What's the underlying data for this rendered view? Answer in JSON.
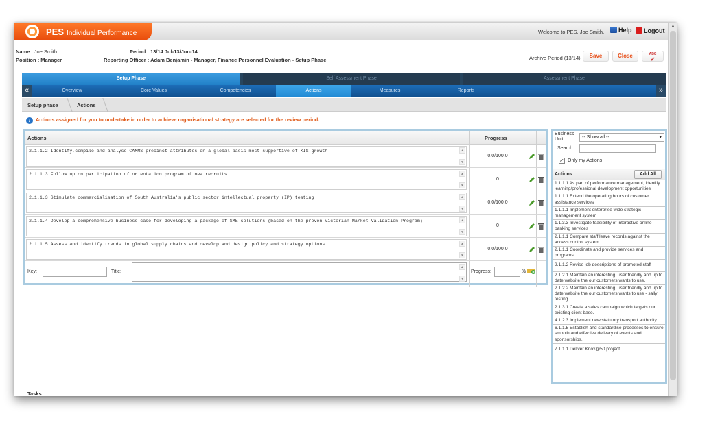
{
  "header": {
    "app_name": "PES",
    "app_subtitle": "Individual Performance",
    "welcome": "Welcome to PES, Joe Smith.",
    "help": "Help",
    "logout": "Logout"
  },
  "info": {
    "name_label": "Name",
    "name_value": ": Joe Smith",
    "position_label": "Position",
    "position_value": ": Manager",
    "period_label": "Period",
    "period_value": ": 13/14 Jul-13/Jun-14",
    "officer_label": "Reporting Officer",
    "officer_value": ": Adam Benjamin - Manager, Finance Personnel Evaluation - Setup Phase",
    "archive_period": "Archive Period (13/14)",
    "save": "Save",
    "close": "Close",
    "spell": "ABC"
  },
  "phases": [
    {
      "label": "Setup Phase",
      "active": true
    },
    {
      "label": "Self Assessment Phase",
      "active": false
    },
    {
      "label": "Assessment Phase",
      "active": false
    }
  ],
  "tabs": [
    {
      "label": "Overview"
    },
    {
      "label": "Core Values"
    },
    {
      "label": "Competencies"
    },
    {
      "label": "Actions"
    },
    {
      "label": "Measures"
    },
    {
      "label": "Reports"
    }
  ],
  "tab_prev": "«",
  "tab_next": "»",
  "breadcrumb": [
    "Setup phase",
    "Actions"
  ],
  "notice": "Actions assigned for you to undertake in order to achieve organisational strategy are selected for the review period.",
  "grid": {
    "col_actions": "Actions",
    "col_progress": "Progress",
    "rows": [
      {
        "text": "2.1.1.2 Identify,compile and analyse CAMMS precinct attributes on a global basis most supportive of KIS growth",
        "progress": "0.0/100.0"
      },
      {
        "text": "2.1.1.3 Follow up on participation of orientation program of new recruits",
        "progress": "0"
      },
      {
        "text": "2.1.1.3 Stimulate commercialisation of South Australia's public sector intellectual property (IP) testing",
        "progress": "0.0/100.0"
      },
      {
        "text": "2.1.1.4 Develop a comprehensive business case for developing a package of SME solutions (based on the proven Victorian Market Validation Program)",
        "progress": "0"
      },
      {
        "text": "2.1.1.5 Assess and identify trends in global supply chains and develop and design policy and strategy options",
        "progress": "0.0/100.0"
      }
    ],
    "new_row": {
      "key_label": "Key:",
      "title_label": "Title:",
      "progress_label": "Progress:",
      "percent": "%"
    }
  },
  "side": {
    "business_unit_label": "Business Unit :",
    "business_unit_value": "-- Show all --",
    "search_label": "Search :",
    "only_mine_label": "Only my Actions",
    "only_mine_checked": "✓",
    "actions_header": "Actions",
    "add_all": "Add All",
    "items": [
      "1.1.1.1 As part of performance management, identify learning/professional development opportunities",
      "1.1.1.1 Extend the operating hours of customer assistance services",
      "1.1.1.1 Implement enterprise wide strategic management system",
      "1.1.3.3 Investigate feasibility of interactive online banking services",
      "2.1.1.1 Compare staff leave records against the access control system",
      "2.1.1.1 Coordinate and provide services and programs",
      "2.1.1.2 Revise job descriptions of promoted staff",
      "2.1.2.1 Maintain an interesting, user friendly and up to date website the our customers wants to use.",
      "2.1.2.2 Maintain an interesting, user friendly and up to date website the our customers wants to use - sally testing.",
      "2.1.3.1 Create a sales campaign which targets our existing client base.",
      "4.1.2.3 Implement new statutory transport authority",
      "6.1.1.5 Establish and standardise processes to ensure smooth and effective delivery of events and sponsorships.",
      "7.1.1.1 Deliver Knox@50 project"
    ]
  },
  "tasks_label": "Tasks",
  "colors": {
    "brand": "#e84c0c",
    "accent": "#2180c8",
    "notice": "#e05b1a"
  }
}
